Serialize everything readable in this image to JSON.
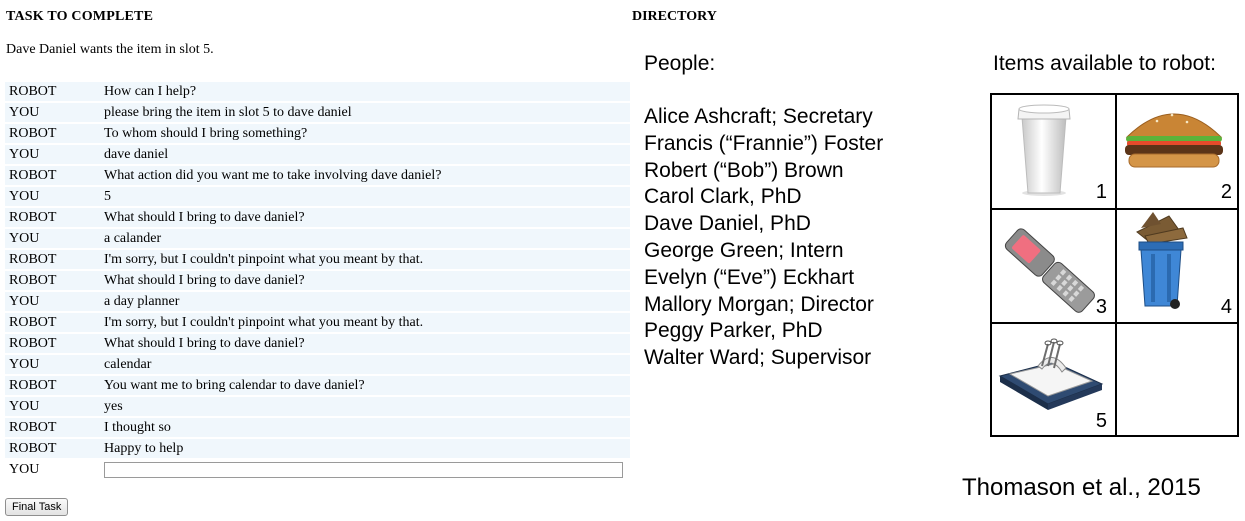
{
  "task": {
    "heading": "TASK TO COMPLETE",
    "description": "Dave Daniel wants the item in slot 5."
  },
  "dialog": [
    {
      "speaker": "ROBOT",
      "text": "How can I help?"
    },
    {
      "speaker": "YOU",
      "text": "please bring the item in slot 5 to dave daniel"
    },
    {
      "speaker": "ROBOT",
      "text": "To whom should I bring something?"
    },
    {
      "speaker": "YOU",
      "text": "dave daniel"
    },
    {
      "speaker": "ROBOT",
      "text": "What action did you want me to take involving dave daniel?"
    },
    {
      "speaker": "YOU",
      "text": "5"
    },
    {
      "speaker": "ROBOT",
      "text": "What should I bring to dave daniel?"
    },
    {
      "speaker": "YOU",
      "text": "a calander"
    },
    {
      "speaker": "ROBOT",
      "text": "I'm sorry, but I couldn't pinpoint what you meant by that."
    },
    {
      "speaker": "ROBOT",
      "text": "What should I bring to dave daniel?"
    },
    {
      "speaker": "YOU",
      "text": "a day planner"
    },
    {
      "speaker": "ROBOT",
      "text": "I'm sorry, but I couldn't pinpoint what you meant by that."
    },
    {
      "speaker": "ROBOT",
      "text": "What should I bring to dave daniel?"
    },
    {
      "speaker": "YOU",
      "text": "calendar"
    },
    {
      "speaker": "ROBOT",
      "text": "You want me to bring calendar to dave daniel?"
    },
    {
      "speaker": "YOU",
      "text": "yes"
    },
    {
      "speaker": "ROBOT",
      "text": "I thought so"
    },
    {
      "speaker": "ROBOT",
      "text": "Happy to help"
    }
  ],
  "input": {
    "speaker": "YOU",
    "value": ""
  },
  "final_button": "Final Task",
  "directory": {
    "heading": "DIRECTORY",
    "people_heading": "People:",
    "people": [
      "Alice Ashcraft; Secretary",
      "Francis (“Frannie”) Foster",
      "Robert (“Bob”) Brown",
      "Carol Clark, PhD",
      "Dave Daniel, PhD",
      "George Green; Intern",
      "Evelyn (“Eve”) Eckhart",
      "Mallory Morgan; Director",
      "Peggy Parker, PhD",
      "Walter Ward; Supervisor"
    ],
    "items_heading": "Items available to robot:",
    "items": [
      {
        "slot": "1",
        "icon": "coffee-cup-icon"
      },
      {
        "slot": "2",
        "icon": "hamburger-icon"
      },
      {
        "slot": "3",
        "icon": "flip-phone-icon"
      },
      {
        "slot": "4",
        "icon": "trash-bin-icon"
      },
      {
        "slot": "5",
        "icon": "desk-calendar-icon"
      }
    ]
  },
  "citation": "Thomason et al., 2015"
}
